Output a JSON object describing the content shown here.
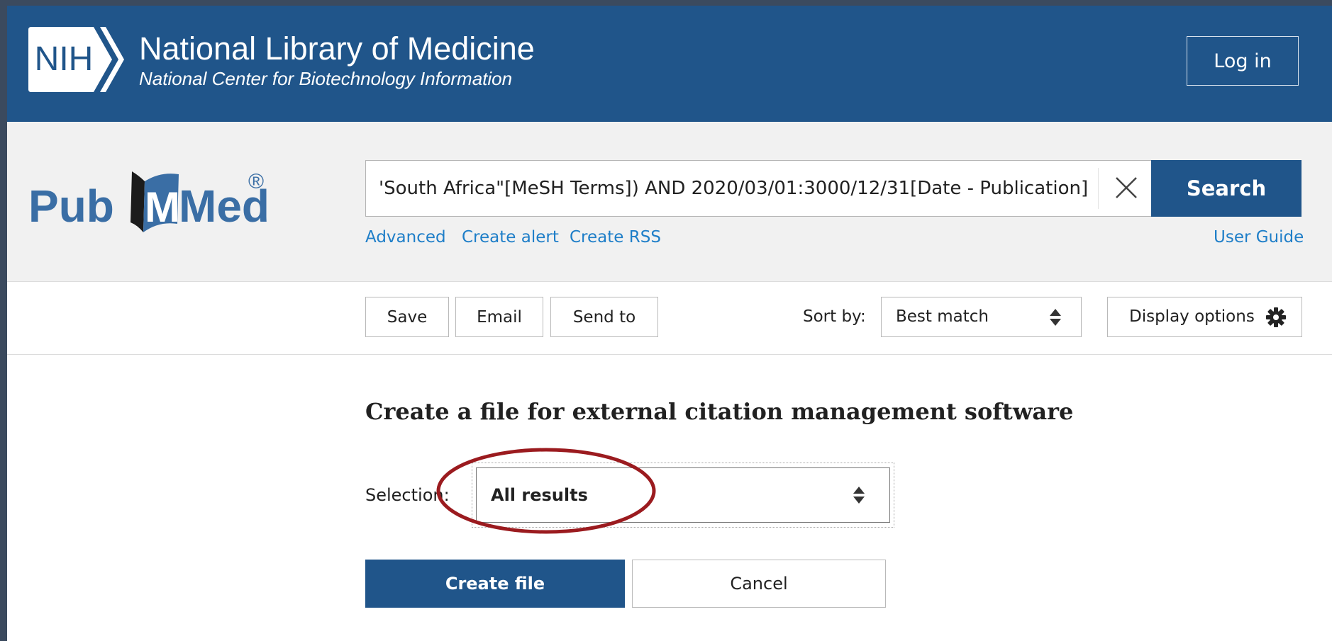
{
  "header": {
    "logo_text": "NIH",
    "title": "National Library of Medicine",
    "subtitle": "National Center for Biotechnology Information",
    "login_label": "Log in"
  },
  "search": {
    "logo_text_left": "Pub",
    "logo_text_right": "Med",
    "logo_mark": "®",
    "query": "'South Africa\"[MeSH Terms]) AND 2020/03/01:3000/12/31[Date - Publication]",
    "button_label": "Search",
    "links": {
      "advanced": "Advanced",
      "create_alert": "Create alert",
      "create_rss": "Create RSS",
      "user_guide": "User Guide"
    }
  },
  "toolbar": {
    "save_label": "Save",
    "email_label": "Email",
    "send_to_label": "Send to",
    "sort_label": "Sort by:",
    "sort_value": "Best match",
    "display_options_label": "Display options"
  },
  "citation_panel": {
    "heading": "Create a file for external citation management software",
    "selection_label": "Selection:",
    "selection_value": "All results",
    "create_file_label": "Create file",
    "cancel_label": "Cancel"
  },
  "colors": {
    "brand_blue": "#20558a",
    "link_blue": "#1e7ec8",
    "annotation_red": "#9b1b1f"
  },
  "icons": {
    "clear": "close-icon",
    "sort": "sort-updown-icon",
    "display": "gear-icon"
  }
}
